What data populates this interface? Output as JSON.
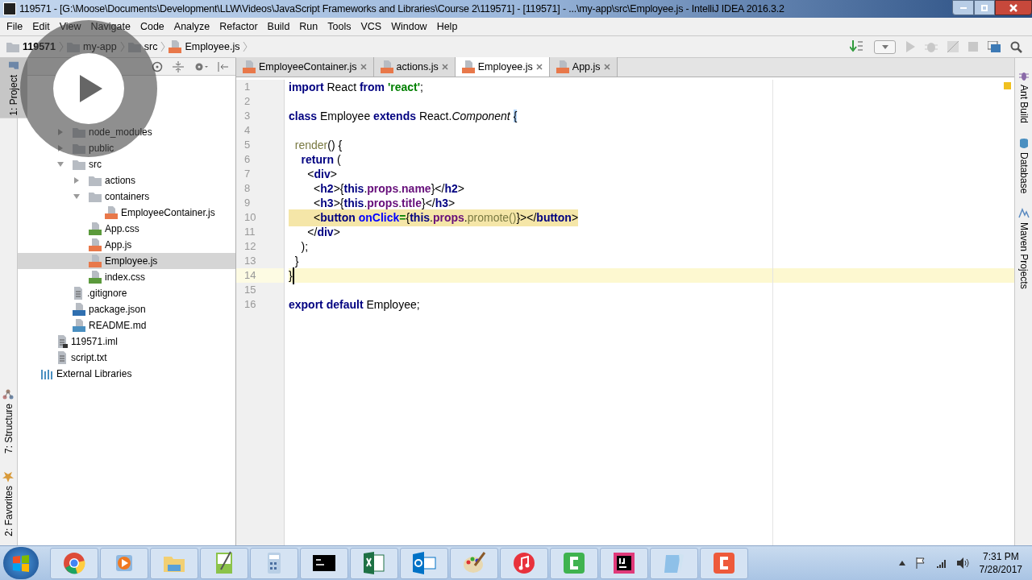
{
  "window": {
    "title": "119571 - [G:\\Moose\\Documents\\Development\\LLW\\Videos\\JavaScript Frameworks and Libraries\\Course 2\\119571] - [119571] - ...\\my-app\\src\\Employee.js - IntelliJ IDEA 2016.3.2"
  },
  "menu": [
    "File",
    "Edit",
    "View",
    "Navigate",
    "Code",
    "Analyze",
    "Refactor",
    "Build",
    "Run",
    "Tools",
    "VCS",
    "Window",
    "Help"
  ],
  "breadcrumbs": [
    {
      "label": "119571",
      "kind": "project"
    },
    {
      "label": "my-app",
      "kind": "folder"
    },
    {
      "label": "src",
      "kind": "folder"
    },
    {
      "label": "Employee.js",
      "kind": "js"
    }
  ],
  "left_tool_windows": [
    {
      "label": "1: Project",
      "selected": true,
      "kind": "project"
    },
    {
      "label": "7: Structure",
      "selected": false,
      "kind": "structure"
    },
    {
      "label": "2: Favorites",
      "selected": false,
      "kind": "favorites"
    }
  ],
  "right_tool_windows": [
    {
      "label": "Ant Build",
      "kind": "ant"
    },
    {
      "label": "Database",
      "kind": "database"
    },
    {
      "label": "Maven Projects",
      "kind": "maven"
    }
  ],
  "tree": [
    {
      "kind": "folder",
      "children": [
        {
          "kind": "folder",
          "children": [
            {
              "label": "node_modules",
              "kind": "folder",
              "expanded": false
            },
            {
              "label": "public",
              "kind": "folder",
              "expanded": false
            },
            {
              "label": "src",
              "kind": "folder",
              "expanded": true,
              "children": [
                {
                  "label": "actions",
                  "kind": "folder",
                  "expanded": false
                },
                {
                  "label": "containers",
                  "kind": "folder",
                  "expanded": true,
                  "children": [
                    {
                      "label": "EmployeeContainer.js",
                      "kind": "js",
                      "selected": false
                    }
                  ]
                },
                {
                  "label": "App.css",
                  "kind": "css",
                  "selected": false
                },
                {
                  "label": "App.js",
                  "kind": "js",
                  "selected": false
                },
                {
                  "label": "Employee.js",
                  "kind": "js",
                  "selected": true
                },
                {
                  "label": "index.css",
                  "kind": "css",
                  "selected": false
                }
              ]
            },
            {
              "label": ".gitignore",
              "kind": "text",
              "selected": false
            },
            {
              "label": "package.json",
              "kind": "json",
              "selected": false
            },
            {
              "label": "README.md",
              "kind": "md",
              "selected": false
            }
          ]
        },
        {
          "label": "119571.iml",
          "kind": "iml",
          "selected": false
        },
        {
          "label": "script.txt",
          "kind": "text",
          "selected": false
        }
      ]
    },
    {
      "label": "External Libraries",
      "kind": "library",
      "selected": false
    }
  ],
  "tabs": [
    {
      "label": "EmployeeContainer.js",
      "selected": false
    },
    {
      "label": "actions.js",
      "selected": false
    },
    {
      "label": "Employee.js",
      "selected": true
    },
    {
      "label": "App.js",
      "selected": false
    }
  ],
  "code_lines": [
    {
      "number": "1",
      "current": false,
      "highlighted": false,
      "tokens": [
        {
          "text": "import",
          "kind": "keyword"
        },
        {
          "text": " React ",
          "kind": "plain"
        },
        {
          "text": "from",
          "kind": "keyword"
        },
        {
          "text": " 'react'",
          "kind": "string"
        },
        {
          "text": ";",
          "kind": "plain"
        }
      ]
    },
    {
      "number": "2",
      "current": false,
      "highlighted": false
    },
    {
      "number": "3",
      "current": false,
      "highlighted": false,
      "tokens": [
        {
          "text": "class",
          "kind": "keyword"
        },
        {
          "text": " Employee ",
          "kind": "plain"
        },
        {
          "text": "extends",
          "kind": "keyword"
        },
        {
          "text": " React.",
          "kind": "plain"
        },
        {
          "text": "Component ",
          "kind": "italic"
        },
        {
          "text": "{",
          "kind": "brace"
        }
      ]
    },
    {
      "number": "4",
      "current": false,
      "highlighted": false
    },
    {
      "number": "5",
      "current": false,
      "highlighted": false,
      "tokens": [
        {
          "text": "  render",
          "kind": "method"
        },
        {
          "text": "() {",
          "kind": "plain"
        }
      ]
    },
    {
      "number": "6",
      "current": false,
      "highlighted": false,
      "tokens": [
        {
          "text": "    return",
          "kind": "keyword"
        },
        {
          "text": " (",
          "kind": "plain"
        }
      ]
    },
    {
      "number": "7",
      "current": false,
      "highlighted": false,
      "tokens": [
        {
          "text": "      <",
          "kind": "plain"
        },
        {
          "text": "div",
          "kind": "keyword"
        },
        {
          "text": ">",
          "kind": "plain"
        }
      ]
    },
    {
      "number": "8",
      "current": false,
      "highlighted": false,
      "tokens": [
        {
          "text": "        <",
          "kind": "plain"
        },
        {
          "text": "h2",
          "kind": "keyword"
        },
        {
          "text": ">{",
          "kind": "plain"
        },
        {
          "text": "this",
          "kind": "keyword"
        },
        {
          "text": ".",
          "kind": "plain"
        },
        {
          "text": "props",
          "kind": "prop"
        },
        {
          "text": ".",
          "kind": "plain"
        },
        {
          "text": "name",
          "kind": "prop"
        },
        {
          "text": "}</",
          "kind": "plain"
        },
        {
          "text": "h2",
          "kind": "keyword"
        },
        {
          "text": ">",
          "kind": "plain"
        }
      ]
    },
    {
      "number": "9",
      "current": false,
      "highlighted": false,
      "tokens": [
        {
          "text": "        <",
          "kind": "plain"
        },
        {
          "text": "h3",
          "kind": "keyword"
        },
        {
          "text": ">{",
          "kind": "plain"
        },
        {
          "text": "this",
          "kind": "keyword"
        },
        {
          "text": ".",
          "kind": "plain"
        },
        {
          "text": "props",
          "kind": "prop"
        },
        {
          "text": ".",
          "kind": "plain"
        },
        {
          "text": "title",
          "kind": "prop"
        },
        {
          "text": "}</",
          "kind": "plain"
        },
        {
          "text": "h3",
          "kind": "keyword"
        },
        {
          "text": ">",
          "kind": "plain"
        }
      ]
    },
    {
      "number": "10",
      "current": false,
      "highlighted": true,
      "tokens": [
        {
          "text": "        <",
          "kind": "plain"
        },
        {
          "text": "button",
          "kind": "keyword"
        },
        {
          "text": " onClick",
          "kind": "attr"
        },
        {
          "text": "=",
          "kind": "equals"
        },
        {
          "text": "{",
          "kind": "plain"
        },
        {
          "text": "this",
          "kind": "keyword"
        },
        {
          "text": ".",
          "kind": "plain"
        },
        {
          "text": "props",
          "kind": "prop"
        },
        {
          "text": ".",
          "kind": "plain"
        },
        {
          "text": "promote()",
          "kind": "method"
        },
        {
          "text": "}></",
          "kind": "plain"
        },
        {
          "text": "button",
          "kind": "keyword"
        },
        {
          "text": ">",
          "kind": "plain"
        }
      ]
    },
    {
      "number": "11",
      "current": false,
      "highlighted": false,
      "tokens": [
        {
          "text": "      </",
          "kind": "plain"
        },
        {
          "text": "div",
          "kind": "keyword"
        },
        {
          "text": ">",
          "kind": "plain"
        }
      ]
    },
    {
      "number": "12",
      "current": false,
      "highlighted": false,
      "tokens": [
        {
          "text": "    );",
          "kind": "plain"
        }
      ]
    },
    {
      "number": "13",
      "current": false,
      "highlighted": false,
      "tokens": [
        {
          "text": "  }",
          "kind": "plain"
        }
      ]
    },
    {
      "number": "14",
      "current": true,
      "highlighted": false,
      "tokens": [
        {
          "text": "}",
          "kind": "plain"
        }
      ]
    },
    {
      "number": "15",
      "current": false,
      "highlighted": false
    },
    {
      "number": "16",
      "current": false,
      "highlighted": false,
      "tokens": [
        {
          "text": "export",
          "kind": "keyword"
        },
        {
          "text": " default",
          "kind": "keyword"
        },
        {
          "text": " Employee;",
          "kind": "plain"
        }
      ]
    }
  ],
  "taskbar": {
    "apps": [
      {
        "kind": "chrome"
      },
      {
        "kind": "media"
      },
      {
        "kind": "explorer"
      },
      {
        "kind": "notepadpp"
      },
      {
        "kind": "calculator"
      },
      {
        "kind": "terminal"
      },
      {
        "kind": "excel"
      },
      {
        "kind": "outlook"
      },
      {
        "kind": "paint"
      },
      {
        "kind": "itunes"
      },
      {
        "kind": "camtasia"
      },
      {
        "kind": "intellij"
      },
      {
        "kind": "notepad"
      },
      {
        "kind": "recorder"
      }
    ],
    "time": "7:31 PM",
    "date": "7/28/2017"
  }
}
